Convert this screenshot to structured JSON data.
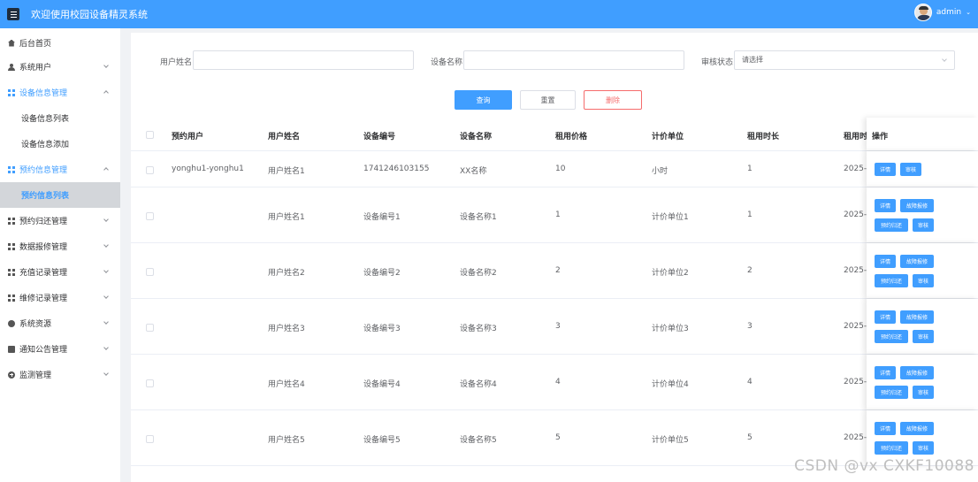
{
  "header": {
    "title": "欢迎使用校园设备精灵系统",
    "user": "admin"
  },
  "sidebar": {
    "home": "后台首页",
    "sys_user": "系统用户",
    "device": "设备信息管理",
    "device_list": "设备信息列表",
    "device_add": "设备信息添加",
    "reserve": "预约信息管理",
    "reserve_list": "预约信息列表",
    "return": "预约归还管理",
    "data": "数据报修管理",
    "recharge": "充值记录管理",
    "repair": "维修记录管理",
    "resource": "系统资源",
    "notice": "通知公告管理",
    "monitor": "监测管理"
  },
  "search": {
    "user_label": "用户姓名",
    "device_label": "设备名称",
    "status_label": "审核状态",
    "status_placeholder": "请选择",
    "query_btn": "查询",
    "reset_btn": "重置",
    "delete_btn": "删除"
  },
  "table": {
    "headers": [
      "预约用户",
      "用户姓名",
      "设备编号",
      "设备名称",
      "租用价格",
      "计价单位",
      "租用时长",
      "租用时间",
      "操作"
    ],
    "rows": [
      [
        "yonghu1-yonghu1",
        "用户姓名1",
        "1741246103155",
        "XX名称",
        "10",
        "小时",
        "1",
        "2025-0"
      ],
      [
        "",
        "用户姓名1",
        "设备编号1",
        "设备名称1",
        "1",
        "计价单位1",
        "1",
        "2025-0"
      ],
      [
        "",
        "用户姓名2",
        "设备编号2",
        "设备名称2",
        "2",
        "计价单位2",
        "2",
        "2025-0"
      ],
      [
        "",
        "用户姓名3",
        "设备编号3",
        "设备名称3",
        "3",
        "计价单位3",
        "3",
        "2025-0"
      ],
      [
        "",
        "用户姓名4",
        "设备编号4",
        "设备名称4",
        "4",
        "计价单位4",
        "4",
        "2025-0"
      ],
      [
        "",
        "用户姓名5",
        "设备编号5",
        "设备名称5",
        "5",
        "计价单位5",
        "5",
        "2025-0"
      ]
    ],
    "ops": {
      "detail": "详情",
      "audit": "审核",
      "fault": "故障报修",
      "reserve_return": "预约归还"
    }
  },
  "watermark": "CSDN @vx  CXKF10088",
  "colors": {
    "primary": "#409eff",
    "danger": "#f56c6c",
    "sidebar_active_bg": "#d3d6da"
  },
  "icons": [
    "hamburger-icon",
    "home-icon",
    "user-icon",
    "grid-icon",
    "chevron-down-icon",
    "chevron-up-icon",
    "plus-circle-icon",
    "document-icon"
  ]
}
